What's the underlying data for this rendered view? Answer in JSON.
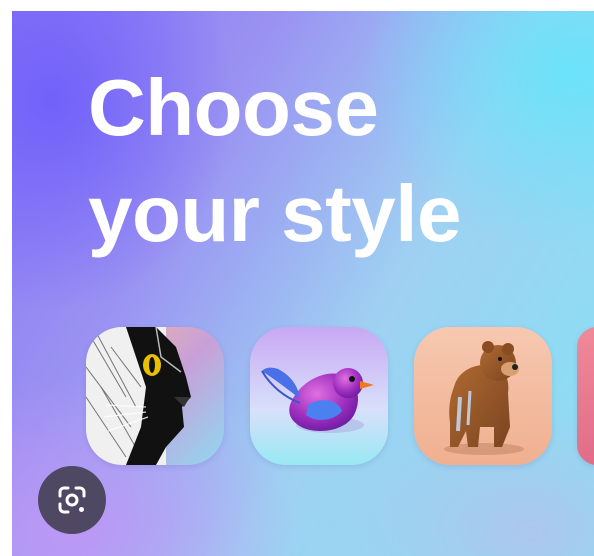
{
  "hero": {
    "line1": "Choose",
    "line2": "your style"
  },
  "styles": [
    {
      "icon": "cat-sketch-icon"
    },
    {
      "icon": "bird-3d-icon"
    },
    {
      "icon": "bear-3d-icon"
    },
    {
      "icon": "partial-style-icon"
    }
  ],
  "lens": {
    "icon": "lens-search-icon"
  },
  "colors": {
    "gradient_purple": "#8a74f6",
    "gradient_cyan": "#86e2f4",
    "title_text": "#ffffff",
    "lens_button_bg": "#403c4e"
  }
}
